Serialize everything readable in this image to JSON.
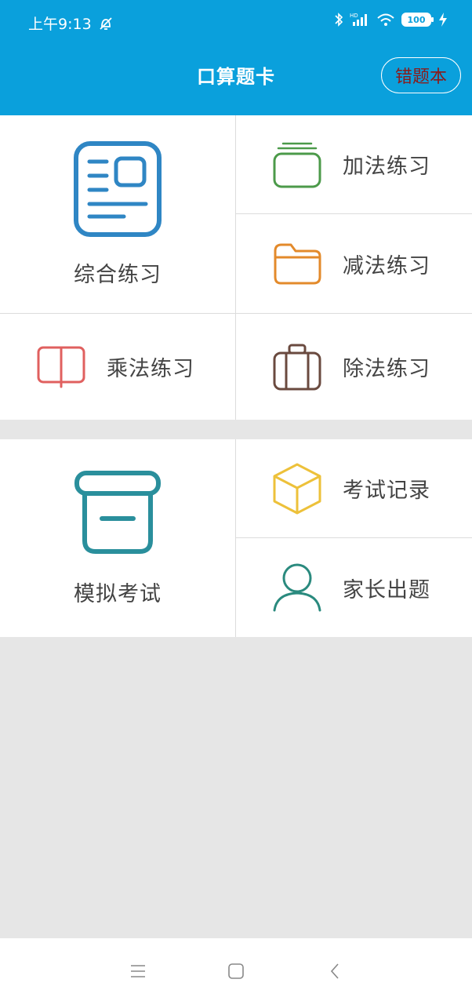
{
  "status": {
    "time": "上午9:13",
    "battery": "100",
    "signal_badge": "HD"
  },
  "header": {
    "title": "口算题卡",
    "wrong_book_label": "错题本"
  },
  "section1": {
    "comprehensive": "综合练习",
    "addition": "加法练习",
    "subtraction": "减法练习",
    "multiplication": "乘法练习",
    "division": "除法练习"
  },
  "section2": {
    "mock_exam": "模拟考试",
    "exam_record": "考试记录",
    "parent_questions": "家长出题"
  },
  "icons": {
    "comprehensive": "document-icon",
    "addition": "layers-icon",
    "subtraction": "folder-icon",
    "multiplication": "book-icon",
    "division": "briefcase-icon",
    "mock_exam": "archive-box-icon",
    "exam_record": "cube-icon",
    "parent_questions": "user-icon"
  },
  "colors": {
    "header": "#0aa0dc",
    "comprehensive": "#2f86c4",
    "addition": "#4c9a4a",
    "subtraction": "#e38a2b",
    "multiplication": "#e0605f",
    "division": "#6a4a3f",
    "mock_exam": "#2a8f9c",
    "exam_record": "#edc13a",
    "parent_questions": "#2a8a7e"
  }
}
